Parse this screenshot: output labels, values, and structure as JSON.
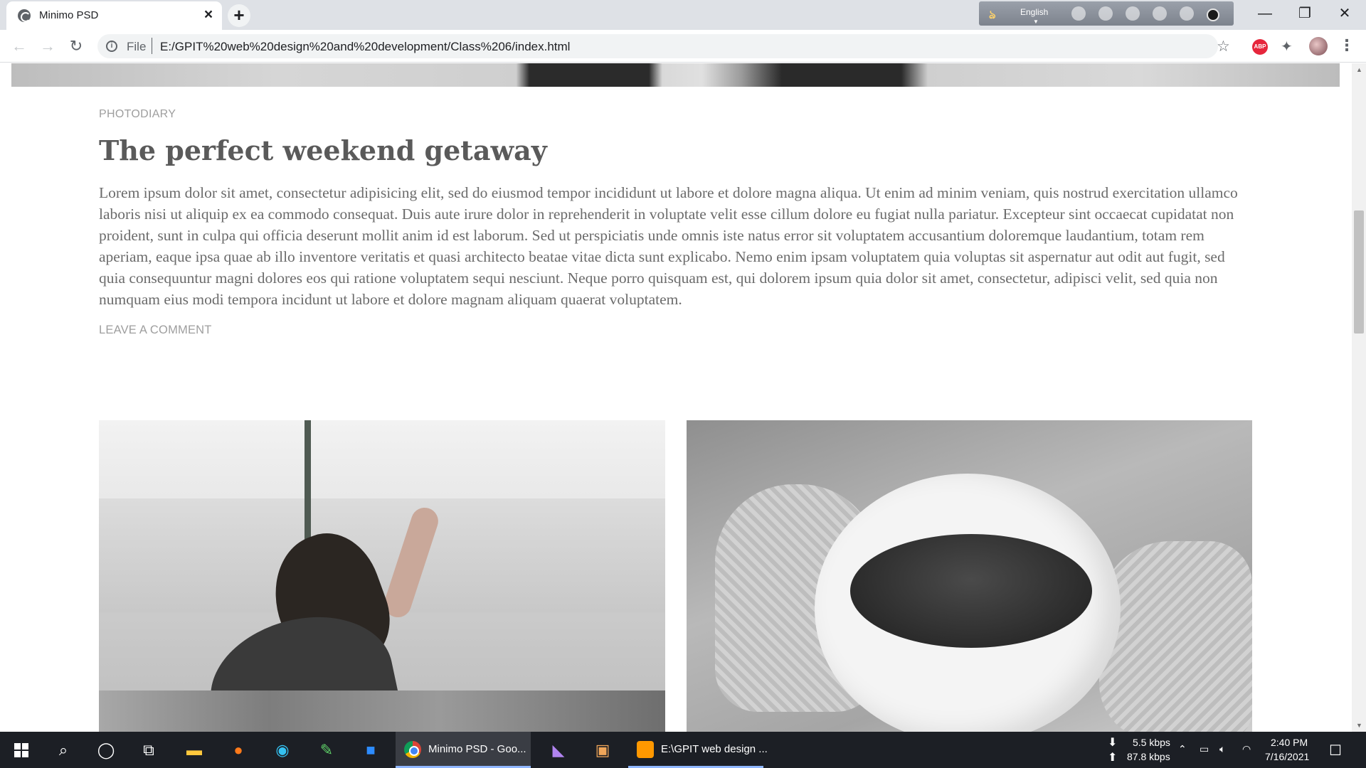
{
  "browser": {
    "tab_title": "Minimo PSD",
    "url_scheme_label": "File",
    "url": "E:/GPIT%20web%20design%20and%20development/Class%206/index.html",
    "language_label": "English",
    "icons": {
      "favicon": "globe-icon",
      "close": "close-icon",
      "new_tab": "plus-icon",
      "back": "arrow-left-icon",
      "forward": "arrow-right-icon",
      "reload": "reload-icon",
      "info": "info-icon",
      "bookmark": "star-icon",
      "extensions": "puzzle-icon",
      "menu": "kebab-menu-icon"
    },
    "extension_abp_label": "ABP"
  },
  "page": {
    "category": "PHOTODIARY",
    "title": "The perfect weekend getaway",
    "body": "Lorem ipsum dolor sit amet, consectetur adipisicing elit, sed do eiusmod tempor incididunt ut labore et dolore magna aliqua. Ut enim ad minim veniam, quis nostrud exercitation ullamco laboris nisi ut aliquip ex ea commodo consequat. Duis aute irure dolor in reprehenderit in voluptate velit esse cillum dolore eu fugiat nulla pariatur. Excepteur sint occaecat cupidatat non proident, sunt in culpa qui officia deserunt mollit anim id est laborum. Sed ut perspiciatis unde omnis iste natus error sit voluptatem accusantium doloremque laudantium, totam rem aperiam, eaque ipsa quae ab illo inventore veritatis et quasi architecto beatae vitae dicta sunt explicabo. Nemo enim ipsam voluptatem quia voluptas sit aspernatur aut odit aut fugit, sed quia consequuntur magni dolores eos qui ratione voluptatem sequi nesciunt. Neque porro quisquam est, qui dolorem ipsum quia dolor sit amet, consectetur, adipisci velit, sed quia non numquam eius modi tempora incidunt ut labore et dolore magnam aliquam quaerat voluptatem.",
    "leave_comment": "LEAVE A COMMENT",
    "colors": {
      "text_muted": "#9e9e9e",
      "title": "#5a5a5a",
      "body": "#6b6b6b"
    }
  },
  "taskbar": {
    "chrome_label": "Minimo PSD - Goo...",
    "sublime_label": "E:\\GPIT web design ...",
    "net_down": "5.5 kbps",
    "net_up": "87.8 kbps",
    "time": "2:40 PM",
    "date": "7/16/2021"
  }
}
